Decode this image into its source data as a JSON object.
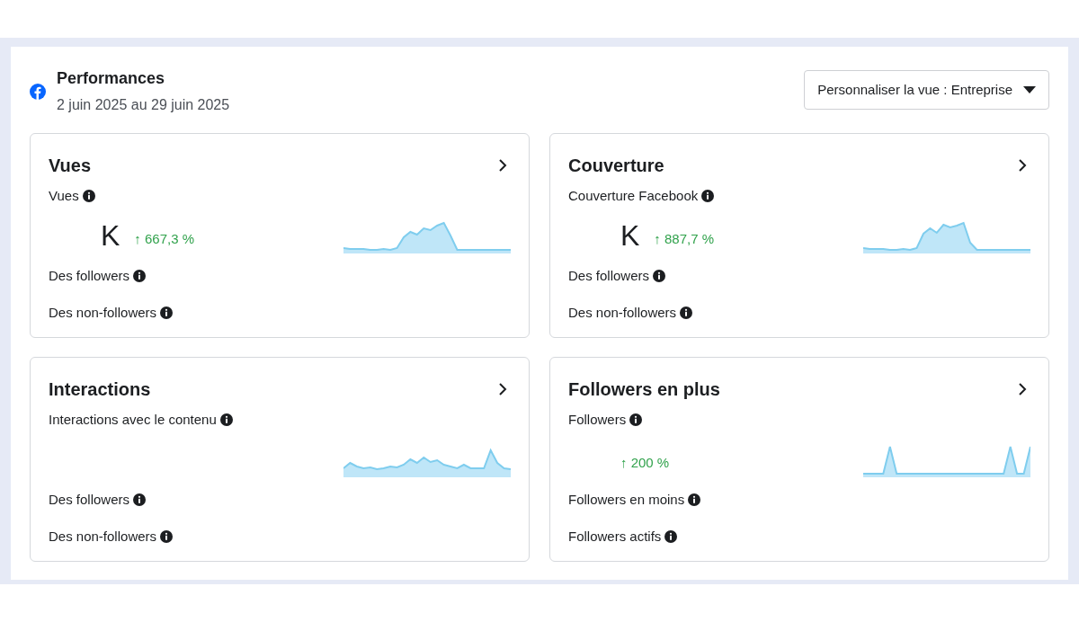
{
  "header": {
    "title": "Performances",
    "date_range": "2 juin 2025 au 29 juin 2025",
    "view_selector": "Personnaliser la vue : Entreprise"
  },
  "cards": [
    {
      "title": "Vues",
      "metric": "Vues",
      "value": "K",
      "change": "↑ 667,3 %",
      "rows": [
        "Des followers",
        "Des non-followers"
      ]
    },
    {
      "title": "Couverture",
      "metric": "Couverture Facebook",
      "value": "K",
      "change": "↑ 887,7 %",
      "rows": [
        "Des followers",
        "Des non-followers"
      ]
    },
    {
      "title": "Interactions",
      "metric": "Interactions avec le contenu",
      "rows": [
        "Des followers",
        "Des non-followers"
      ]
    },
    {
      "title": "Followers en plus",
      "metric": "Followers",
      "change": "↑ 200 %",
      "rows": [
        "Followers en moins",
        "Followers actifs"
      ]
    }
  ]
}
